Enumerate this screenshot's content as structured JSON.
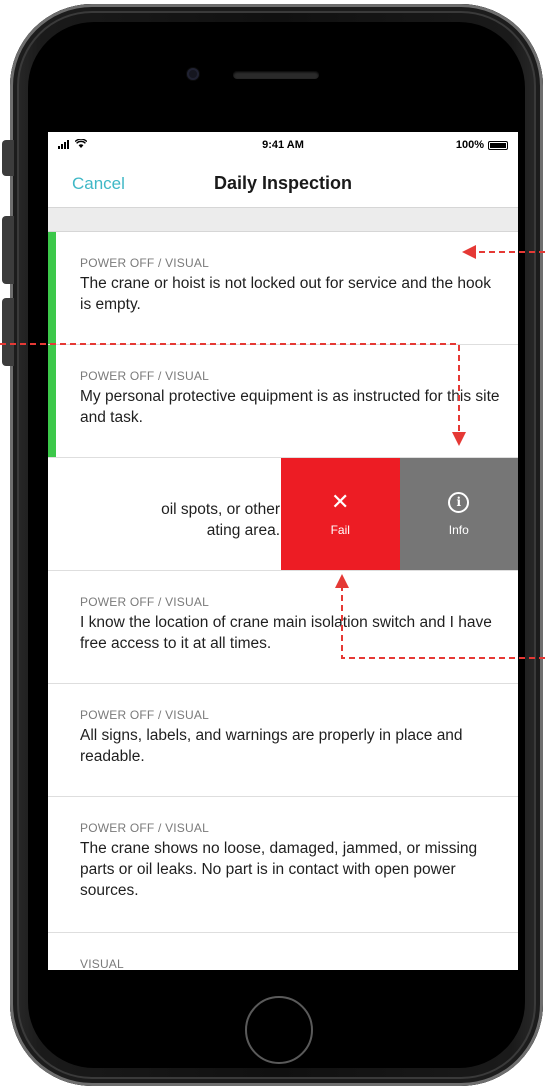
{
  "status_bar": {
    "time": "9:41 AM",
    "battery": "100%"
  },
  "nav": {
    "cancel_label": "Cancel",
    "title": "Daily Inspection"
  },
  "rows": [
    {
      "category": "POWER OFF / VISUAL",
      "text": "The crane or hoist is not locked out for service and the hook is empty.",
      "status": "passed"
    },
    {
      "category": "POWER OFF / VISUAL",
      "text": "My personal protective equipment is as instructed for this site and task.",
      "status": "passed"
    },
    {
      "text_partial": "oil spots, or other\nating area.",
      "actions": {
        "fail_label": "Fail",
        "info_label": "Info"
      }
    },
    {
      "category": "POWER OFF / VISUAL",
      "text": "I know the location of crane main isolation switch and I have free access to it at all times."
    },
    {
      "category": "POWER OFF / VISUAL",
      "text": "All signs, labels, and warnings are properly in place and readable."
    },
    {
      "category": "POWER OFF / VISUAL",
      "text": "The crane shows no loose, damaged, jammed, or missing parts or oil leaks. No part is in contact with open power sources."
    },
    {
      "category": "VISUAL",
      "text": ""
    }
  ],
  "colors": {
    "accent": "#3fb8c6",
    "pass_stripe": "#3cc84a",
    "fail": "#ed1c24",
    "info": "#767676",
    "annotation_arrow": "#e53935"
  },
  "icons": [
    "signal-icon",
    "wifi-icon",
    "battery-icon",
    "close-x-icon",
    "info-circle-icon"
  ]
}
